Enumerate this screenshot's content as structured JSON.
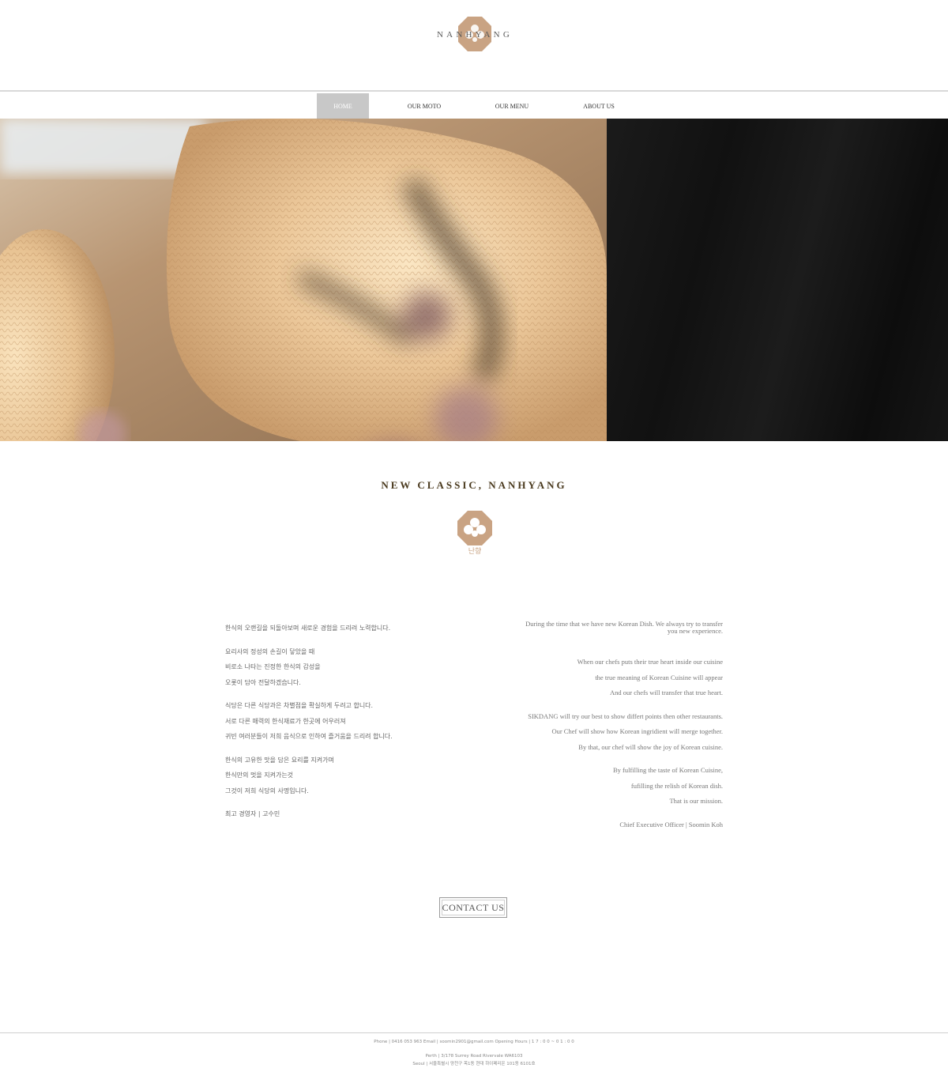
{
  "brand": {
    "name": "NANHYANG",
    "emblem_text": "난향",
    "color": "#c9a383"
  },
  "nav": {
    "items": [
      {
        "label": "HOME",
        "active": true
      },
      {
        "label": "OUR MOTO",
        "active": false
      },
      {
        "label": "OUR MENU",
        "active": false
      },
      {
        "label": "ABOUT US",
        "active": false
      }
    ]
  },
  "section": {
    "title": "NEW CLASSIC, NANHYANG"
  },
  "korean_text": [
    [
      "한식의 오랜길을 되돌아보며 새로운 경험을 드리려 노력합니다."
    ],
    [
      "요리사의 정성의 손길이 닿았을 때",
      "비로소 나타는 진정한 한식의 감성을",
      "오롯이 담아 전달하겠습니다."
    ],
    [
      "식당은 다른 식당과은 차별점을 확실하게 두려고 합니다.",
      "서로 다른 매력의 한식재료가 한곳에 어우러져",
      "귀빈 여러분들이 저희 음식으로 인하여 즐거움을 드리려 합니다."
    ],
    [
      "한식의 고유한 맛을 담은 요리를 지켜가며",
      "한식만의 멋을 지켜가는것",
      "그것이 저희 식당의 사명입니다."
    ],
    [
      "최고 경영자 | 고수민"
    ]
  ],
  "english_text": [
    [
      "During the time that we have new Korean Dish. We always try to transfer you new experience."
    ],
    [
      "When our chefs puts their true heart inside our cuisine",
      "the true meaning of Korean Cuisine will appear",
      "And our chefs will transfer that true heart."
    ],
    [
      "SIKDANG will try our best to show differt points then other restaurants.",
      "Our Chef will show how Korean ingridient will merge together.",
      "By that, our chef will show the joy of Korean cuisine."
    ],
    [
      "By fulfilling the taste of Korean Cuisine,",
      "fufilling the relish of Korean dish.",
      "That is our mission."
    ],
    [
      "Chief Executive Officer | Soomin Koh"
    ]
  ],
  "contact": {
    "label": "CONTACT US"
  },
  "footer": {
    "line1": "Phone | 0416 053 963  Email | soomin2901@gmail.com  Opening Hours | 1 7 : 0 0 ~ 0 1 : 0 0",
    "line2": "Perth | 3/178 Surrey Road Rivervale WA6103",
    "line3": "Seoul | 서울특별시 양천구 목1동 현대 하이페리온 101동 6101호"
  }
}
